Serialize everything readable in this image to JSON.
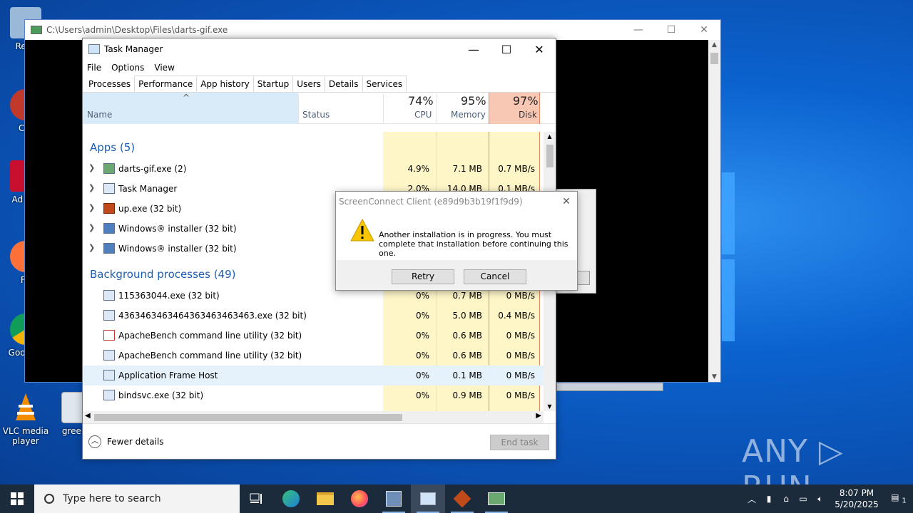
{
  "desktop": {
    "icons": [
      {
        "label": "Recy"
      },
      {
        "label": "CCl"
      },
      {
        "label": "Ad Acr"
      },
      {
        "label": "Fir"
      },
      {
        "label": "Goo Chr"
      },
      {
        "label": "VLC media player"
      },
      {
        "label": "greenp"
      }
    ],
    "watermark": "ANY ▷ RUN"
  },
  "app_window": {
    "title": "C:\\Users\\admin\\Desktop\\Files\\darts-gif.exe",
    "controls": [
      "—",
      "☐",
      "✕"
    ]
  },
  "task_manager": {
    "title": "Task Manager",
    "menu": [
      "File",
      "Options",
      "View"
    ],
    "tabs": [
      "Processes",
      "Performance",
      "App history",
      "Startup",
      "Users",
      "Details",
      "Services"
    ],
    "columns": {
      "name": "Name",
      "status": "Status",
      "cpu": {
        "pct": "74%",
        "label": "CPU"
      },
      "memory": {
        "pct": "95%",
        "label": "Memory"
      },
      "disk": {
        "pct": "97%",
        "label": "Disk"
      }
    },
    "groups": {
      "apps": "Apps (5)",
      "background": "Background processes (49)"
    },
    "apps": [
      {
        "name": "darts-gif.exe (2)",
        "cpu": "4.9%",
        "mem": "7.1 MB",
        "disk": "0.7 MB/s"
      },
      {
        "name": "Task Manager",
        "cpu": "2.0%",
        "mem": "14.0 MB",
        "disk": "0.1 MB/s"
      },
      {
        "name": "up.exe (32 bit)",
        "cpu": "",
        "mem": "",
        "disk": ""
      },
      {
        "name": "Windows® installer (32 bit)",
        "cpu": "",
        "mem": "",
        "disk": ""
      },
      {
        "name": "Windows® installer (32 bit)",
        "cpu": "",
        "mem": "",
        "disk": ""
      }
    ],
    "background": [
      {
        "name": "115363044.exe (32 bit)",
        "cpu": "0%",
        "mem": "0.7 MB",
        "disk": "0 MB/s"
      },
      {
        "name": "4363463463464363463463463.exe (32 bit)",
        "cpu": "0%",
        "mem": "5.0 MB",
        "disk": "0.4 MB/s"
      },
      {
        "name": "ApacheBench command line utility (32 bit)",
        "cpu": "0%",
        "mem": "0.6 MB",
        "disk": "0 MB/s"
      },
      {
        "name": "ApacheBench command line utility (32 bit)",
        "cpu": "0%",
        "mem": "0.6 MB",
        "disk": "0 MB/s"
      },
      {
        "name": "Application Frame Host",
        "cpu": "0%",
        "mem": "0.1 MB",
        "disk": "0 MB/s"
      },
      {
        "name": "bindsvc.exe (32 bit)",
        "cpu": "0%",
        "mem": "0.9 MB",
        "disk": "0 MB/s"
      }
    ],
    "fewer_details": "Fewer details",
    "end_task": "End task"
  },
  "dialog": {
    "title": "ScreenConnect Client (e89d9b3b19f1f9d9)",
    "message": "Another installation is in progress. You must complete that installation before continuing this one.",
    "retry": "Retry",
    "cancel": "Cancel"
  },
  "taskbar": {
    "search_placeholder": "Type here to search",
    "time": "8:07 PM",
    "date": "5/20/2025",
    "notification_count": "1"
  },
  "colors": {
    "desktop_blue": "#0a63c9",
    "disk_highlight": "#f9c8b5",
    "column_highlight": "#fff6c8",
    "group_blue": "#1c5fb3",
    "taskbar": "#1b2b3b"
  }
}
